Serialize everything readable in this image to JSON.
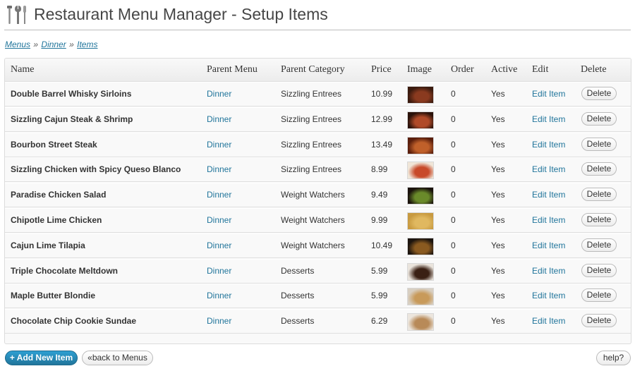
{
  "header": {
    "title": "Restaurant Menu Manager - Setup Items"
  },
  "breadcrumb": {
    "menus": "Menus",
    "sep1": "»",
    "dinner": "Dinner",
    "sep2": "»",
    "items": "Items"
  },
  "table": {
    "columns": {
      "name": "Name",
      "parent_menu": "Parent Menu",
      "parent_category": "Parent Category",
      "price": "Price",
      "image": "Image",
      "order": "Order",
      "active": "Active",
      "edit": "Edit",
      "delete": "Delete"
    },
    "rows": [
      {
        "name": "Double Barrel Whisky Sirloins",
        "menu": "Dinner",
        "category": "Sizzling Entrees",
        "price": "10.99",
        "order": "0",
        "active": "Yes",
        "edit": "Edit Item",
        "delete": "Delete",
        "thumb": [
          "#3a1a0e",
          "#8a3a1f",
          "#e9e2d6"
        ]
      },
      {
        "name": "Sizzling Cajun Steak & Shrimp",
        "menu": "Dinner",
        "category": "Sizzling Entrees",
        "price": "12.99",
        "order": "0",
        "active": "Yes",
        "edit": "Edit Item",
        "delete": "Delete",
        "thumb": [
          "#2b120a",
          "#b04a28",
          "#dcc9b0"
        ]
      },
      {
        "name": "Bourbon Street Steak",
        "menu": "Dinner",
        "category": "Sizzling Entrees",
        "price": "13.49",
        "order": "0",
        "active": "Yes",
        "edit": "Edit Item",
        "delete": "Delete",
        "thumb": [
          "#5a1e0c",
          "#c0602a",
          "#7a2e14"
        ]
      },
      {
        "name": "Sizzling Chicken with Spicy Queso Blanco",
        "menu": "Dinner",
        "category": "Sizzling Entrees",
        "price": "8.99",
        "order": "0",
        "active": "Yes",
        "edit": "Edit Item",
        "delete": "Delete",
        "thumb": [
          "#f0e6d8",
          "#c84a2a",
          "#e8c48a"
        ]
      },
      {
        "name": "Paradise Chicken Salad",
        "menu": "Dinner",
        "category": "Weight Watchers",
        "price": "9.49",
        "order": "0",
        "active": "Yes",
        "edit": "Edit Item",
        "delete": "Delete",
        "thumb": [
          "#1a120c",
          "#6a8a2a",
          "#c8a050"
        ]
      },
      {
        "name": "Chipotle Lime Chicken",
        "menu": "Dinner",
        "category": "Weight Watchers",
        "price": "9.99",
        "order": "0",
        "active": "Yes",
        "edit": "Edit Item",
        "delete": "Delete",
        "thumb": [
          "#c89a40",
          "#e0b860",
          "#7a4a1a"
        ]
      },
      {
        "name": "Cajun Lime Tilapia",
        "menu": "Dinner",
        "category": "Weight Watchers",
        "price": "10.49",
        "order": "0",
        "active": "Yes",
        "edit": "Edit Item",
        "delete": "Delete",
        "thumb": [
          "#1c140e",
          "#8a5a20",
          "#d8b878"
        ]
      },
      {
        "name": "Triple Chocolate Meltdown",
        "menu": "Dinner",
        "category": "Desserts",
        "price": "5.99",
        "order": "0",
        "active": "Yes",
        "edit": "Edit Item",
        "delete": "Delete",
        "thumb": [
          "#eae4dc",
          "#3a2014",
          "#c8b8a0"
        ]
      },
      {
        "name": "Maple Butter Blondie",
        "menu": "Dinner",
        "category": "Desserts",
        "price": "5.99",
        "order": "0",
        "active": "Yes",
        "edit": "Edit Item",
        "delete": "Delete",
        "thumb": [
          "#d8cfc2",
          "#c89a5a",
          "#3a2818"
        ]
      },
      {
        "name": "Chocolate Chip Cookie Sundae",
        "menu": "Dinner",
        "category": "Desserts",
        "price": "6.29",
        "order": "0",
        "active": "Yes",
        "edit": "Edit Item",
        "delete": "Delete",
        "thumb": [
          "#ece6de",
          "#b88a58",
          "#5a3a20"
        ]
      }
    ]
  },
  "footer": {
    "add_label": "+ Add New Item",
    "back_label": "«back to Menus",
    "help_label": "help?"
  }
}
